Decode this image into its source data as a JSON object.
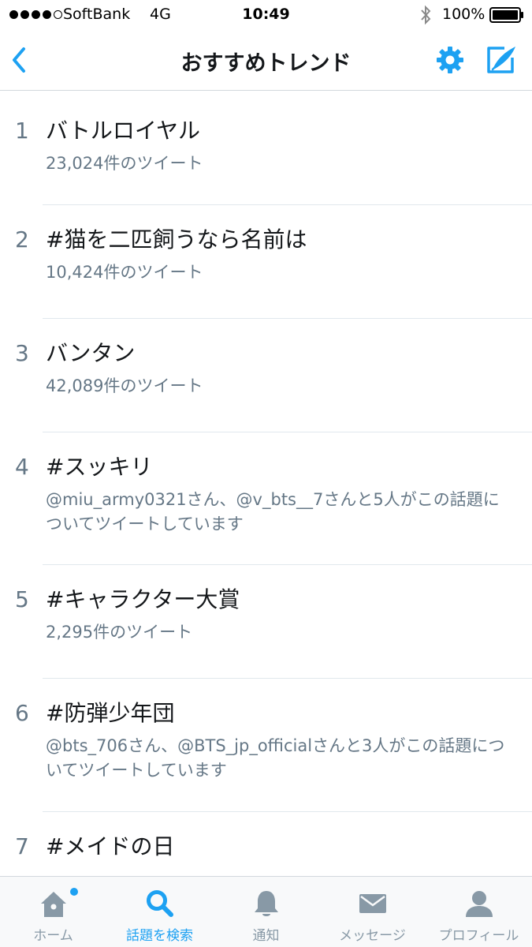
{
  "status_bar": {
    "carrier": "SoftBank",
    "network": "4G",
    "time": "10:49",
    "battery": "100%",
    "signal_icon": "signal-dots-icon",
    "bluetooth_icon": "bluetooth-icon",
    "battery_icon": "battery-full-icon"
  },
  "nav": {
    "title": "おすすめトレンド",
    "back_icon": "chevron-left-icon",
    "settings_icon": "gear-icon",
    "compose_icon": "compose-icon"
  },
  "colors": {
    "accent": "#1da1f2",
    "text_primary": "#14171a",
    "text_secondary": "#657786",
    "divider": "#e1e8ed"
  },
  "trends": [
    {
      "rank": "1",
      "name": "バトルロイヤル",
      "meta": "23,024件のツイート"
    },
    {
      "rank": "2",
      "name": "#猫を二匹飼うなら名前は",
      "meta": "10,424件のツイート"
    },
    {
      "rank": "3",
      "name": "バンタン",
      "meta": "42,089件のツイート"
    },
    {
      "rank": "4",
      "name": "#スッキリ",
      "meta": "@miu_army0321さん、@v_bts__7さんと5人がこの話題についてツイートしています"
    },
    {
      "rank": "5",
      "name": "#キャラクター大賞",
      "meta": "2,295件のツイート"
    },
    {
      "rank": "6",
      "name": "#防弾少年団",
      "meta": "@bts_706さん、@BTS_jp_officialさんと3人がこの話題についてツイートしています"
    },
    {
      "rank": "7",
      "name": "#メイドの日",
      "meta": ""
    }
  ],
  "tabs": [
    {
      "label": "ホーム",
      "icon": "home-icon",
      "has_badge": true
    },
    {
      "label": "話題を検索",
      "icon": "search-icon",
      "active": true
    },
    {
      "label": "通知",
      "icon": "bell-icon"
    },
    {
      "label": "メッセージ",
      "icon": "envelope-icon"
    },
    {
      "label": "プロフィール",
      "icon": "person-icon"
    }
  ]
}
